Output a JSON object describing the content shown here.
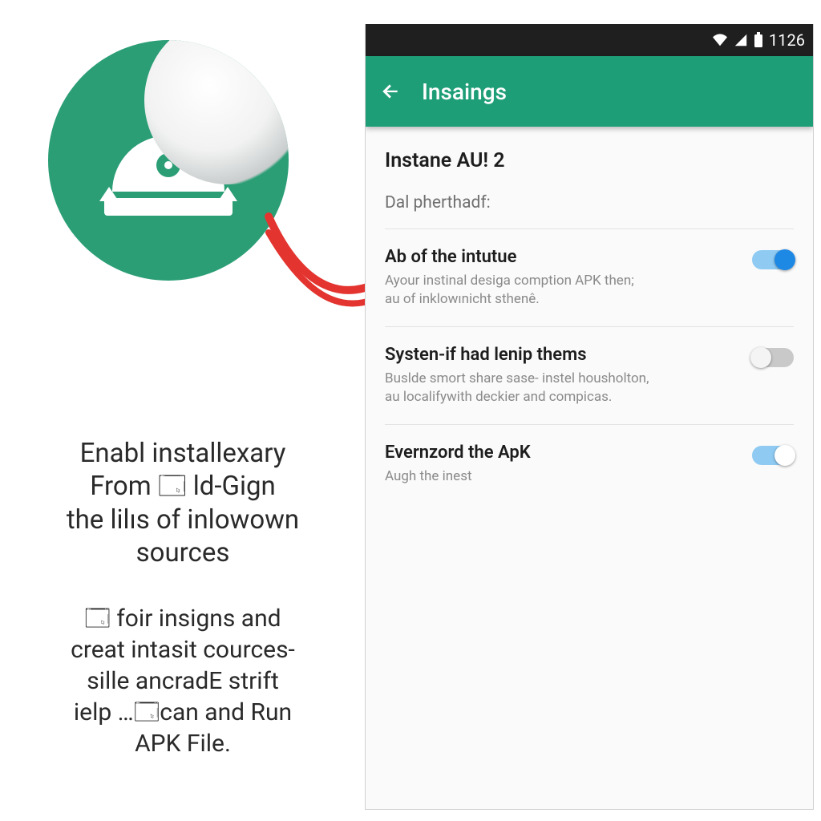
{
  "left": {
    "paragraph1": "Enabl  installexary\nFrom  🗔  ld-Gign\nthe lilıs of inlowown\nsources",
    "paragraph2": "🗔  foir insigns and\ncreat intasit cources-\nsille ancradE strift\nielp …🗔can and Run\nAPK File."
  },
  "statusbar": {
    "time": "1126"
  },
  "appbar": {
    "title": "Insaings"
  },
  "section": {
    "title": "Instane AU! 2",
    "subtitle": "Dal pherthadf:"
  },
  "settings": [
    {
      "title": "Ab of the intutue",
      "desc": "Ayour instinal desiga comption APK then;\nau of inklowınicht sthenê.",
      "on": true,
      "whiteKnob": false
    },
    {
      "title": "Systen-if had lenip thems",
      "desc": "Buslde smort share sase- instel housholton,\nau localifywith deckier and compicas.",
      "on": false,
      "whiteKnob": false
    },
    {
      "title": "Evernzord the ApK",
      "desc": "Augh the inest",
      "on": true,
      "whiteKnob": true
    }
  ]
}
